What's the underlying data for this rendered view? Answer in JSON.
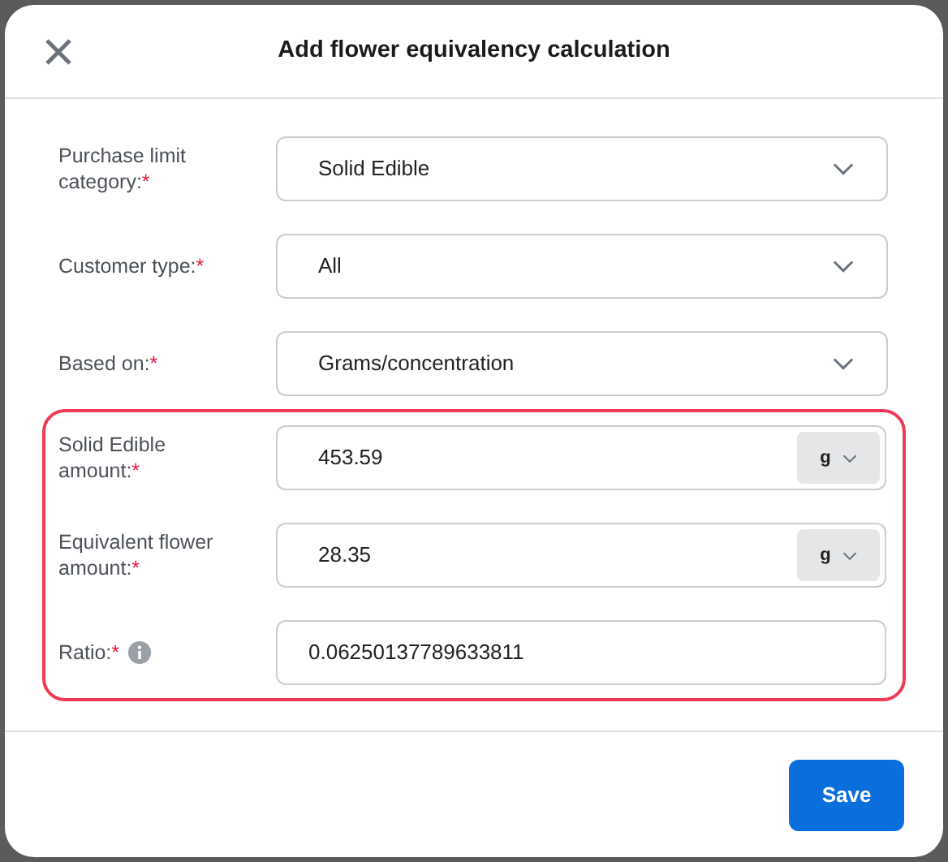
{
  "dialog": {
    "title": "Add flower equivalency calculation"
  },
  "sections": [
    {
      "highlighted": false,
      "fields": [
        {
          "kind": "select",
          "label": "Purchase limit category:",
          "required_mark": "*",
          "value": "Solid Edible"
        },
        {
          "kind": "select",
          "label": "Customer type:",
          "required_mark": "*",
          "value": "All"
        },
        {
          "kind": "select",
          "label": "Based on:",
          "required_mark": "*",
          "value": "Grams/concentration"
        }
      ]
    },
    {
      "highlighted": true,
      "fields": [
        {
          "kind": "amount",
          "label": "Solid Edible amount:",
          "required_mark": "*",
          "value": "453.59",
          "unit": "g"
        },
        {
          "kind": "amount",
          "label": "Equivalent flower amount:",
          "required_mark": "*",
          "value": "28.35",
          "unit": "g"
        },
        {
          "kind": "text",
          "label": "Ratio:",
          "required_mark": "*",
          "value": "0.06250137789633811",
          "info": true
        }
      ]
    }
  ],
  "buttons": [
    {
      "label": "Save"
    }
  ]
}
